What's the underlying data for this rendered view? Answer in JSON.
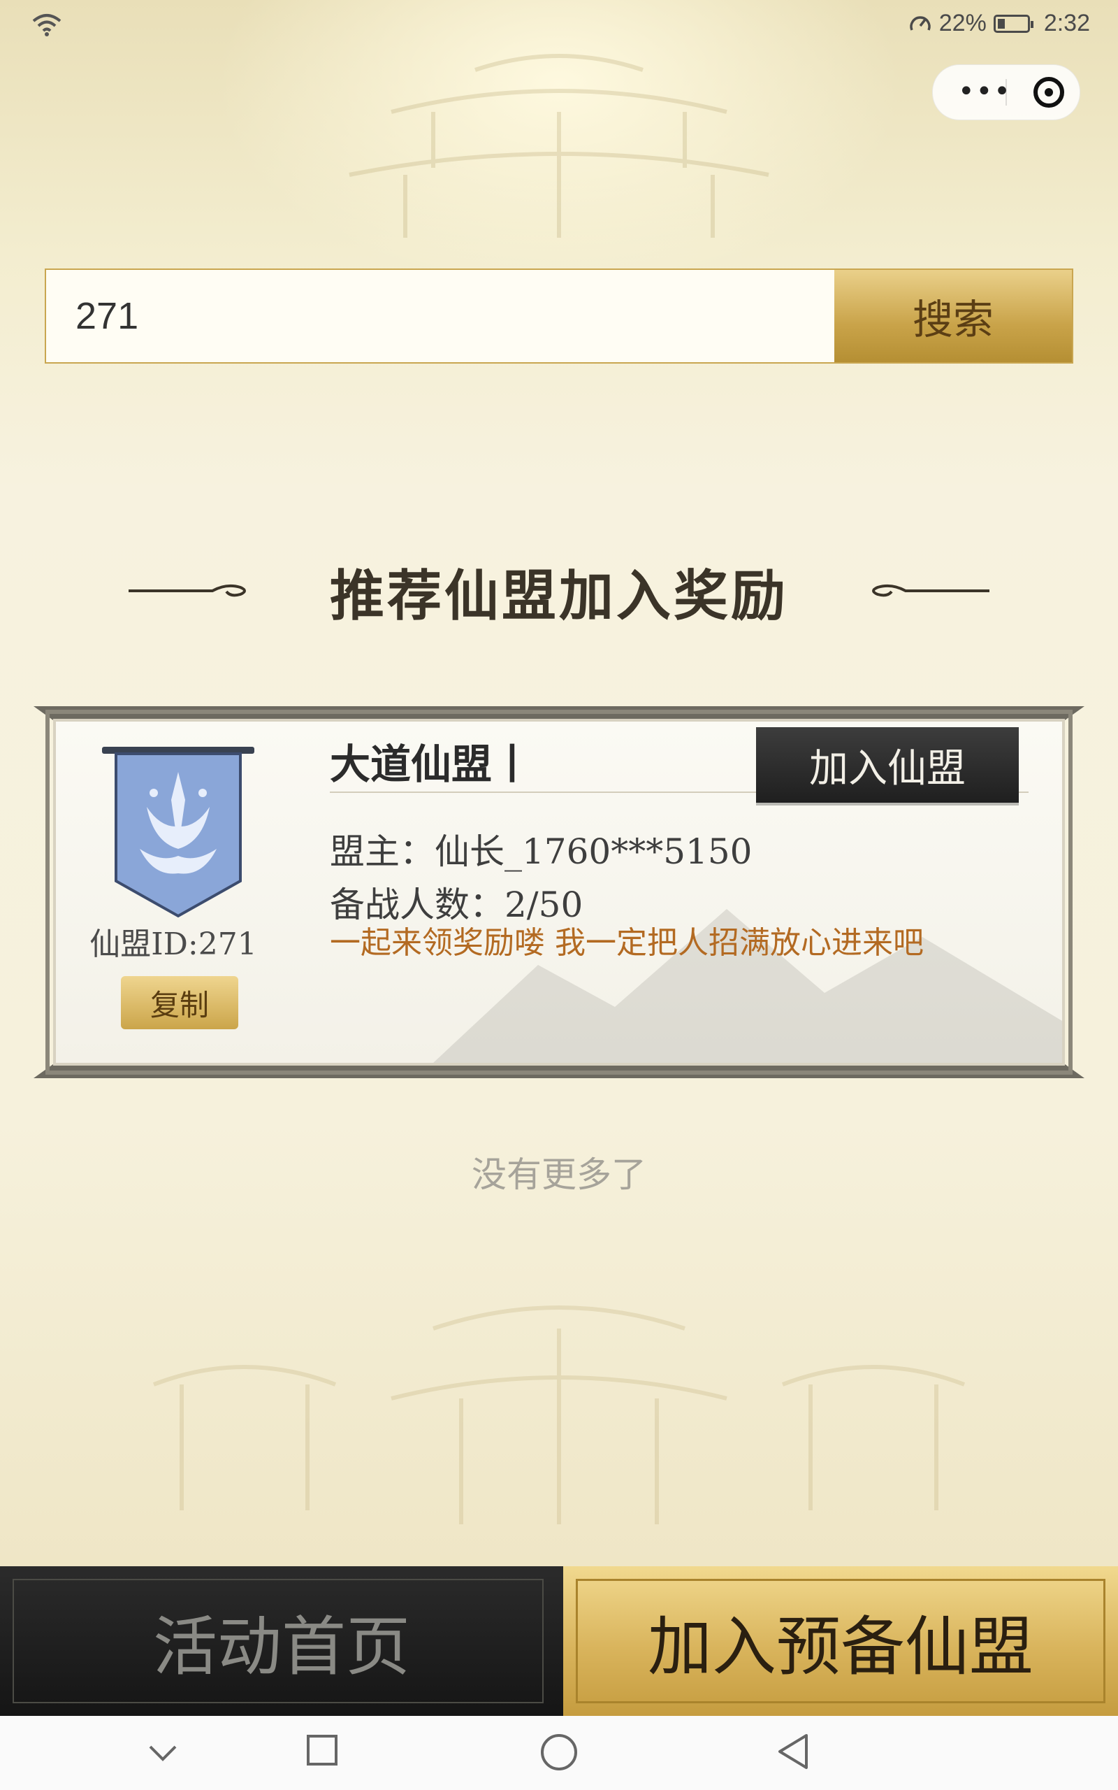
{
  "status_bar": {
    "battery_percent": "22%",
    "time": "2:32",
    "icons": [
      "wifi-icon",
      "speedometer-icon",
      "battery-icon"
    ]
  },
  "capsule": {
    "more_label": "•••",
    "icons": [
      "more-dots-icon",
      "close-target-icon"
    ]
  },
  "search": {
    "value": "271",
    "button_label": "搜索"
  },
  "section": {
    "title": "推荐仙盟加入奖励"
  },
  "alliance": {
    "name": "大道仙盟丨",
    "join_label": "加入仙盟",
    "leader": "盟主：仙长_1760***5150",
    "members": "备战人数：2/50",
    "slogan": "一起来领奖励喽 我一定把人招满放心进来吧",
    "id_text": "仙盟ID:271",
    "copy_label": "复制"
  },
  "list_end_text": "没有更多了",
  "bottom_bar": {
    "home_label": "活动首页",
    "reserve_label": "加入预备仙盟"
  },
  "nav_bar": {
    "icons": [
      "chevron-down-icon",
      "square-icon",
      "circle-icon",
      "back-triangle-icon"
    ]
  },
  "colors": {
    "gold": "#c9a349",
    "dark": "#1f1f1f",
    "slogan": "#b36a22",
    "banner_blue": "#8aa6d8"
  }
}
